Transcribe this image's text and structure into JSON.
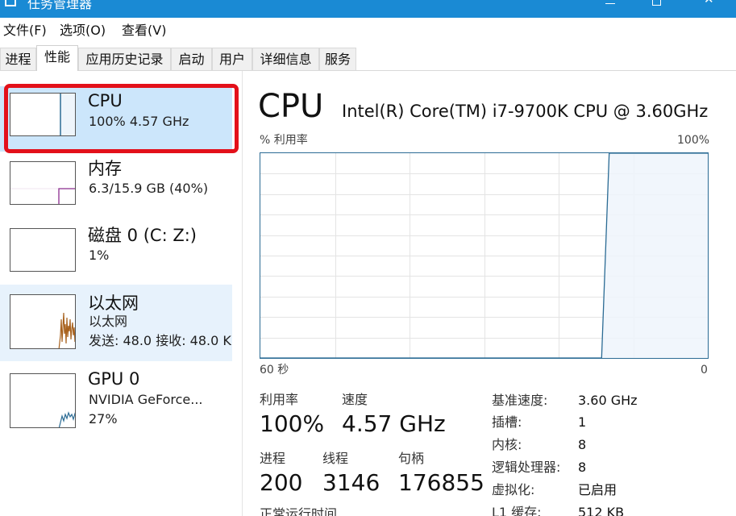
{
  "window": {
    "title": "任务管理器"
  },
  "menu": [
    "文件(F)",
    "选项(O)",
    "查看(V)"
  ],
  "tabs": [
    {
      "label": "进程"
    },
    {
      "label": "性能"
    },
    {
      "label": "应用历史记录"
    },
    {
      "label": "启动"
    },
    {
      "label": "用户"
    },
    {
      "label": "详细信息"
    },
    {
      "label": "服务"
    }
  ],
  "active_tab": "性能",
  "resources": [
    {
      "name": "CPU",
      "line1": "100% 4.57 GHz",
      "line2": ""
    },
    {
      "name": "内存",
      "line1": "6.3/15.9 GB (40%)",
      "line2": ""
    },
    {
      "name": "磁盘 0 (C: Z:)",
      "line1": "1%",
      "line2": ""
    },
    {
      "name": "以太网",
      "line1": "以太网",
      "line2": "发送: 48.0 接收: 48.0 K"
    },
    {
      "name": "GPU 0",
      "line1": "NVIDIA GeForce...",
      "line2": "27%"
    }
  ],
  "detail": {
    "title": "CPU",
    "model": "Intel(R) Core(TM) i7-9700K CPU @ 3.60GHz",
    "util_axis_label": "% 利用率",
    "util_axis_max": "100%",
    "time_axis_left": "60 秒",
    "time_axis_right": "0",
    "stats": {
      "util_label": "利用率",
      "util_value": "100%",
      "speed_label": "速度",
      "speed_value": "4.57 GHz",
      "proc_label": "进程",
      "proc_value": "200",
      "threads_label": "线程",
      "threads_value": "3146",
      "handles_label": "句柄",
      "handles_value": "176855",
      "uptime_label": "正常运行时间"
    },
    "specs": [
      {
        "key": "基准速度:",
        "value": "3.60 GHz"
      },
      {
        "key": "插槽:",
        "value": "1"
      },
      {
        "key": "内核:",
        "value": "8"
      },
      {
        "key": "逻辑处理器:",
        "value": "8"
      },
      {
        "key": "虚拟化:",
        "value": "已启用"
      },
      {
        "key": "L1 缓存:",
        "value": "512 KB"
      }
    ]
  },
  "colors": {
    "titlebar": "#1a8ad4",
    "selected_item": "#cce6fb",
    "cpu_line": "#2b6b94",
    "cpu_fill": "#eef5fb",
    "memory_line": "#8b2c8e",
    "disk_line": "#4a7a2e",
    "ethernet_line": "#a8621e",
    "gpu_line": "#2b6b94",
    "annotation": "#e3101a"
  },
  "cpu_history": [
    0,
    0,
    0,
    0,
    0,
    0,
    0,
    0,
    0,
    0,
    0,
    0,
    0,
    0,
    0,
    0,
    0,
    0,
    0,
    0,
    0,
    0,
    0,
    0,
    0,
    0,
    0,
    0,
    0,
    0,
    0,
    0,
    0,
    0,
    0,
    0,
    0,
    0,
    0,
    0,
    0,
    0,
    0,
    0,
    0,
    0,
    100,
    100,
    100,
    100,
    100,
    100,
    100,
    100,
    100,
    100,
    100,
    100,
    100,
    100
  ]
}
